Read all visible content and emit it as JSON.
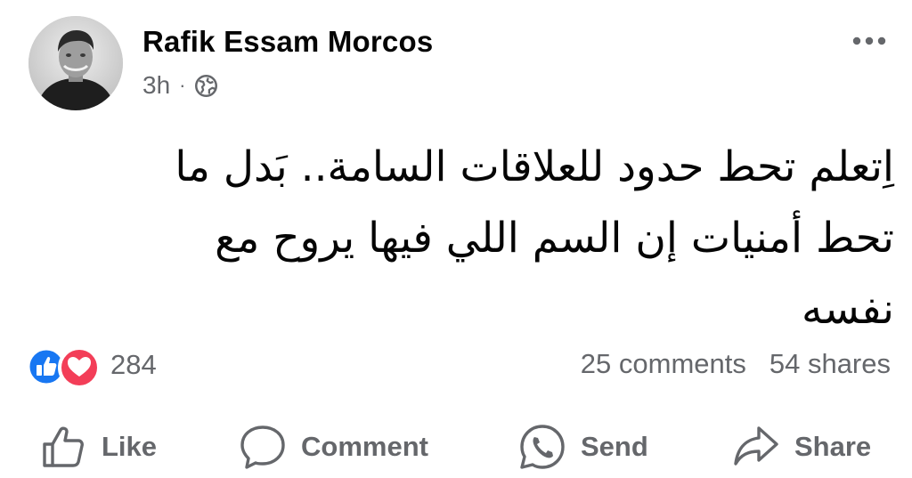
{
  "post": {
    "author": "Rafik Essam Morcos",
    "time": "3h",
    "separator": "·",
    "privacy_icon": "globe-icon",
    "more_icon": "more-options-icon",
    "text_lines": [
      "اِتعلم تحط حدود للعلاقات السامة.. بَدل ما",
      "تحط أمنيات إن السم اللي فيها يروح مع",
      "نفسه"
    ]
  },
  "reactions": {
    "icons": [
      "like-reaction-icon",
      "love-reaction-icon"
    ],
    "count": "284",
    "comments": "25 comments",
    "shares": "54 shares"
  },
  "actions": {
    "like": "Like",
    "comment": "Comment",
    "send": "Send",
    "share": "Share"
  },
  "colors": {
    "like_blue": "#1877f2",
    "love_red": "#f33e58",
    "secondary_text": "#65676b"
  }
}
